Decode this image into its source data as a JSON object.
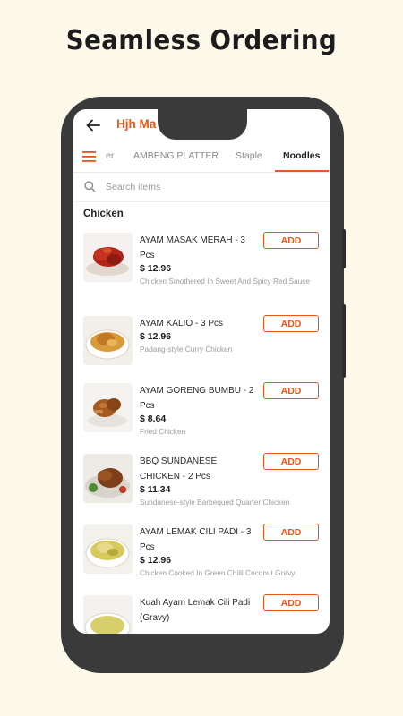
{
  "headline": "Seamless Ordering",
  "app": {
    "title": "Hjh Ma            hiat",
    "tabs": [
      {
        "label": "er"
      },
      {
        "label": "AMBENG PLATTER"
      },
      {
        "label": "Staple"
      },
      {
        "label": "Noodles",
        "active": true
      }
    ],
    "search_placeholder": "Search items",
    "section": "Chicken",
    "add_label": "ADD",
    "accent_color": "#e8561a",
    "items": [
      {
        "name": "AYAM MASAK MERAH - 3 Pcs",
        "price": "$ 12.96",
        "desc": "Chicken Smothered In Sweet And Spicy Red Sauce",
        "image": "red-chicken-dish"
      },
      {
        "name": "AYAM KALIO - 3 Pcs",
        "price": "$ 12.96",
        "desc": "Padang-style Curry Chicken",
        "image": "curry-chicken-bowl"
      },
      {
        "name": "AYAM GORENG BUMBU - 2 Pcs",
        "price": "$ 8.64",
        "desc": "Fried Chicken",
        "image": "fried-chicken-plate"
      },
      {
        "name": "BBQ SUNDANESE CHICKEN - 2 Pcs",
        "price": "$ 11.34",
        "desc": "Sundanese-style Barbequed  Quarter Chicken",
        "image": "bbq-chicken-plate"
      },
      {
        "name": "AYAM LEMAK CILI PADI - 3 Pcs",
        "price": "$ 12.96",
        "desc": "Chicken Cooked In Green Chilli Coconut Gravy",
        "image": "green-curry-chicken-bowl"
      },
      {
        "name": "Kuah Ayam Lemak Cili Padi (Gravy)",
        "price": "",
        "desc": "",
        "image": "gravy-bowl"
      }
    ]
  }
}
